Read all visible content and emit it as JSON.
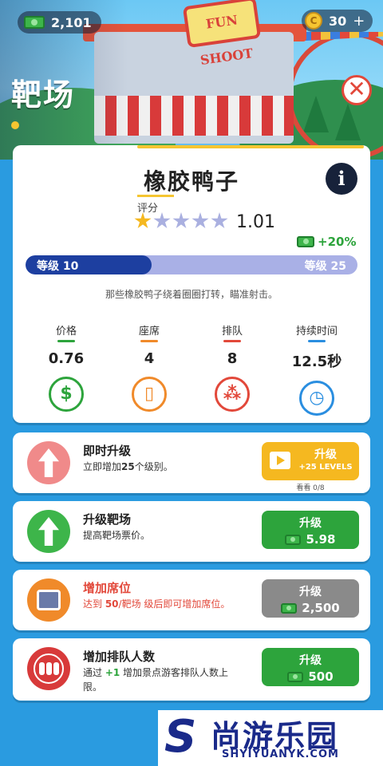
{
  "hud": {
    "cash": "2,101",
    "coins": "30",
    "coin_symbol": "C",
    "plus_symbol": "+"
  },
  "page": {
    "title": "靶场",
    "close_symbol": "✕"
  },
  "attraction": {
    "name": "橡胶鸭子",
    "info_symbol": "i",
    "rating_label": "评分",
    "rating_stars": 1,
    "rating_max": 5,
    "rating_value": "1.01",
    "bonus": "+20%",
    "level_current": "等级 10",
    "level_max": "等级 25",
    "level_progress": 0.38,
    "description": "那些橡胶鸭子绕着圈圈打转，瞄准射击。"
  },
  "stats": [
    {
      "label": "价格",
      "value": "0.76",
      "color": "#2da43c",
      "icon": "dollar-icon",
      "glyph": "$"
    },
    {
      "label": "座席",
      "value": "4",
      "color": "#f08a2a",
      "icon": "seat-icon",
      "glyph": "▯"
    },
    {
      "label": "排队",
      "value": "8",
      "color": "#e2483a",
      "icon": "queue-icon",
      "glyph": "⁂"
    },
    {
      "label": "持续时间",
      "value": "12.5秒",
      "color": "#2a8ee0",
      "icon": "clock-icon",
      "glyph": "◷"
    }
  ],
  "upgrades": [
    {
      "title": "即时升级",
      "desc_prefix": "立即增加",
      "desc_highlight": "25",
      "desc_suffix": "个级别。",
      "icon": "arrow-up-icon",
      "icon_bg": "#f08a8a",
      "button_label": "升级",
      "button_sub": "+25 LEVELS",
      "button_color": "#f5b820",
      "watch_note": "看看 0/8"
    },
    {
      "title": "升级靶场",
      "desc": "提高靶场票价。",
      "icon": "arrow-up-icon",
      "icon_bg": "#3db54a",
      "button_label": "升级",
      "button_value": "5.98",
      "button_color": "#2da43c"
    },
    {
      "title": "增加席位",
      "desc_prefix": "达到 ",
      "desc_highlight": "50",
      "desc_suffix": "/靶场 级后即可增加席位。",
      "icon": "seat-icon",
      "icon_bg": "#f08a2a",
      "button_label": "升级",
      "button_value": "2,500",
      "button_color": "#8a8a8a",
      "title_color": "#e2483a"
    },
    {
      "title": "增加排队人数",
      "desc_prefix": "通过 ",
      "desc_highlight": "+1",
      "desc_suffix": " 增加景点游客排队人数上限。",
      "icon": "queue-icon",
      "icon_bg": "#d83a3a",
      "button_label": "升级",
      "button_value": "500",
      "button_color": "#2da43c"
    }
  ],
  "scene": {
    "booth_sign": "FUN SHOOT"
  },
  "watermark": {
    "logo_letter": "S",
    "brand": "尚游乐园",
    "url": "SHYIYUANYK.COM"
  },
  "colors": {
    "background": "#2a9be0",
    "level_fill": "#1d3fa0",
    "level_track": "#a9b0e6",
    "accent_green": "#2da43c",
    "accent_yellow": "#f5b820"
  }
}
